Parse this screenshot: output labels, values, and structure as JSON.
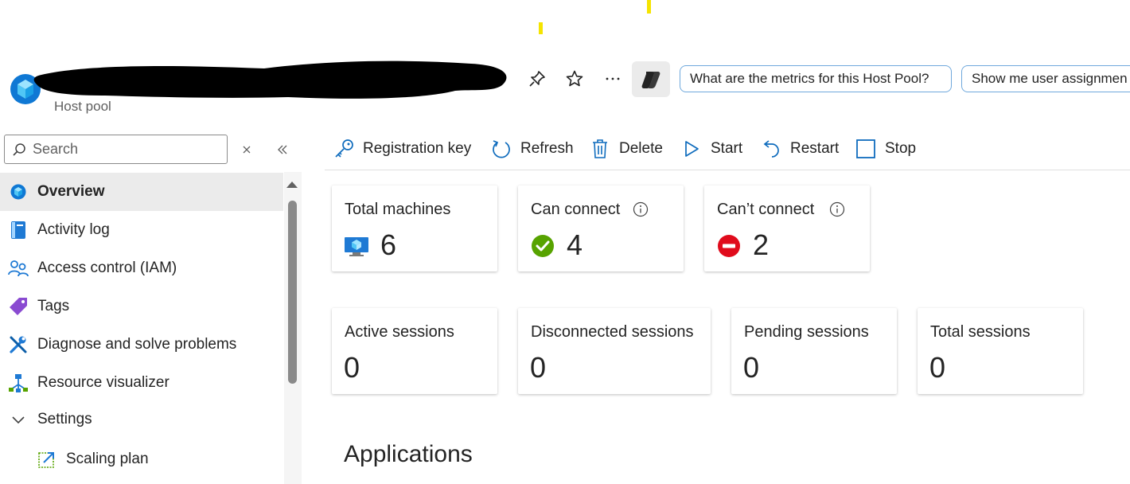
{
  "header": {
    "resource_type": "Host pool",
    "icon": "host-pool-icon",
    "actions": [
      "pin-icon",
      "star-icon",
      "more-icon",
      "copilot-icon"
    ],
    "prompts": [
      "What are the metrics for this Host Pool?",
      "Show me user assignmen"
    ]
  },
  "sidebar": {
    "search_placeholder": "Search",
    "items": [
      {
        "label": "Overview",
        "icon": "overview-icon",
        "active": true
      },
      {
        "label": "Activity log",
        "icon": "activity-log-icon"
      },
      {
        "label": "Access control (IAM)",
        "icon": "access-control-icon"
      },
      {
        "label": "Tags",
        "icon": "tag-icon"
      },
      {
        "label": "Diagnose and solve problems",
        "icon": "wrench-icon"
      },
      {
        "label": "Resource visualizer",
        "icon": "visualizer-icon"
      },
      {
        "label": "Settings",
        "icon": "chevron-down-icon"
      },
      {
        "label": "Scaling plan",
        "icon": "scaling-plan-icon"
      }
    ]
  },
  "toolbar": {
    "registration_key": "Registration key",
    "refresh": "Refresh",
    "delete": "Delete",
    "start": "Start",
    "restart": "Restart",
    "stop": "Stop"
  },
  "machines": [
    {
      "title": "Total machines",
      "value": "6",
      "icon": "virtual-machine-icon"
    },
    {
      "title": "Can connect",
      "value": "4",
      "icon": "check-circle-icon"
    },
    {
      "title": "Can’t connect",
      "value": "2",
      "icon": "blocked-icon"
    }
  ],
  "sessions": [
    {
      "title": "Active sessions",
      "value": "0"
    },
    {
      "title": "Disconnected sessions",
      "value": "0"
    },
    {
      "title": "Pending sessions",
      "value": "0"
    },
    {
      "title": "Total sessions",
      "value": "0"
    }
  ],
  "main": {
    "section_heading": "Applications"
  },
  "colors": {
    "accent": "#0f6cbd",
    "success": "#57a300",
    "error": "#e00b1c",
    "selected_bg": "#ebebeb",
    "annotation_yellow": "#f5e400"
  }
}
